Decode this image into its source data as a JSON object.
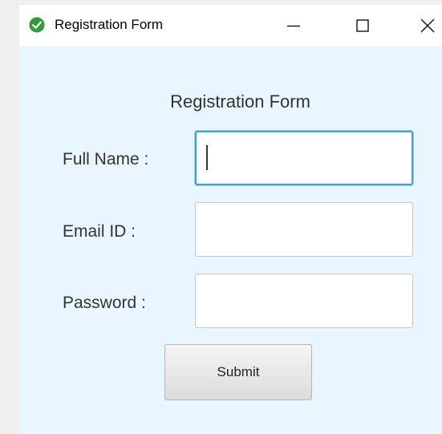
{
  "window": {
    "title": "Registration Form",
    "icon": "check-circle-icon",
    "controls": {
      "minimize_icon": "minimize-icon",
      "maximize_icon": "maximize-icon",
      "close_icon": "close-icon"
    }
  },
  "form": {
    "heading": "Registration Form",
    "fields": [
      {
        "label": "Full Name :",
        "value": "",
        "focused": true
      },
      {
        "label": "Email ID :",
        "value": ""
      },
      {
        "label": "Password :",
        "value": ""
      }
    ],
    "submit_label": "Submit"
  },
  "colors": {
    "background": "#eaf6ff",
    "focus_border": "#3fa0d9",
    "icon_green": "#2e9e3a"
  }
}
